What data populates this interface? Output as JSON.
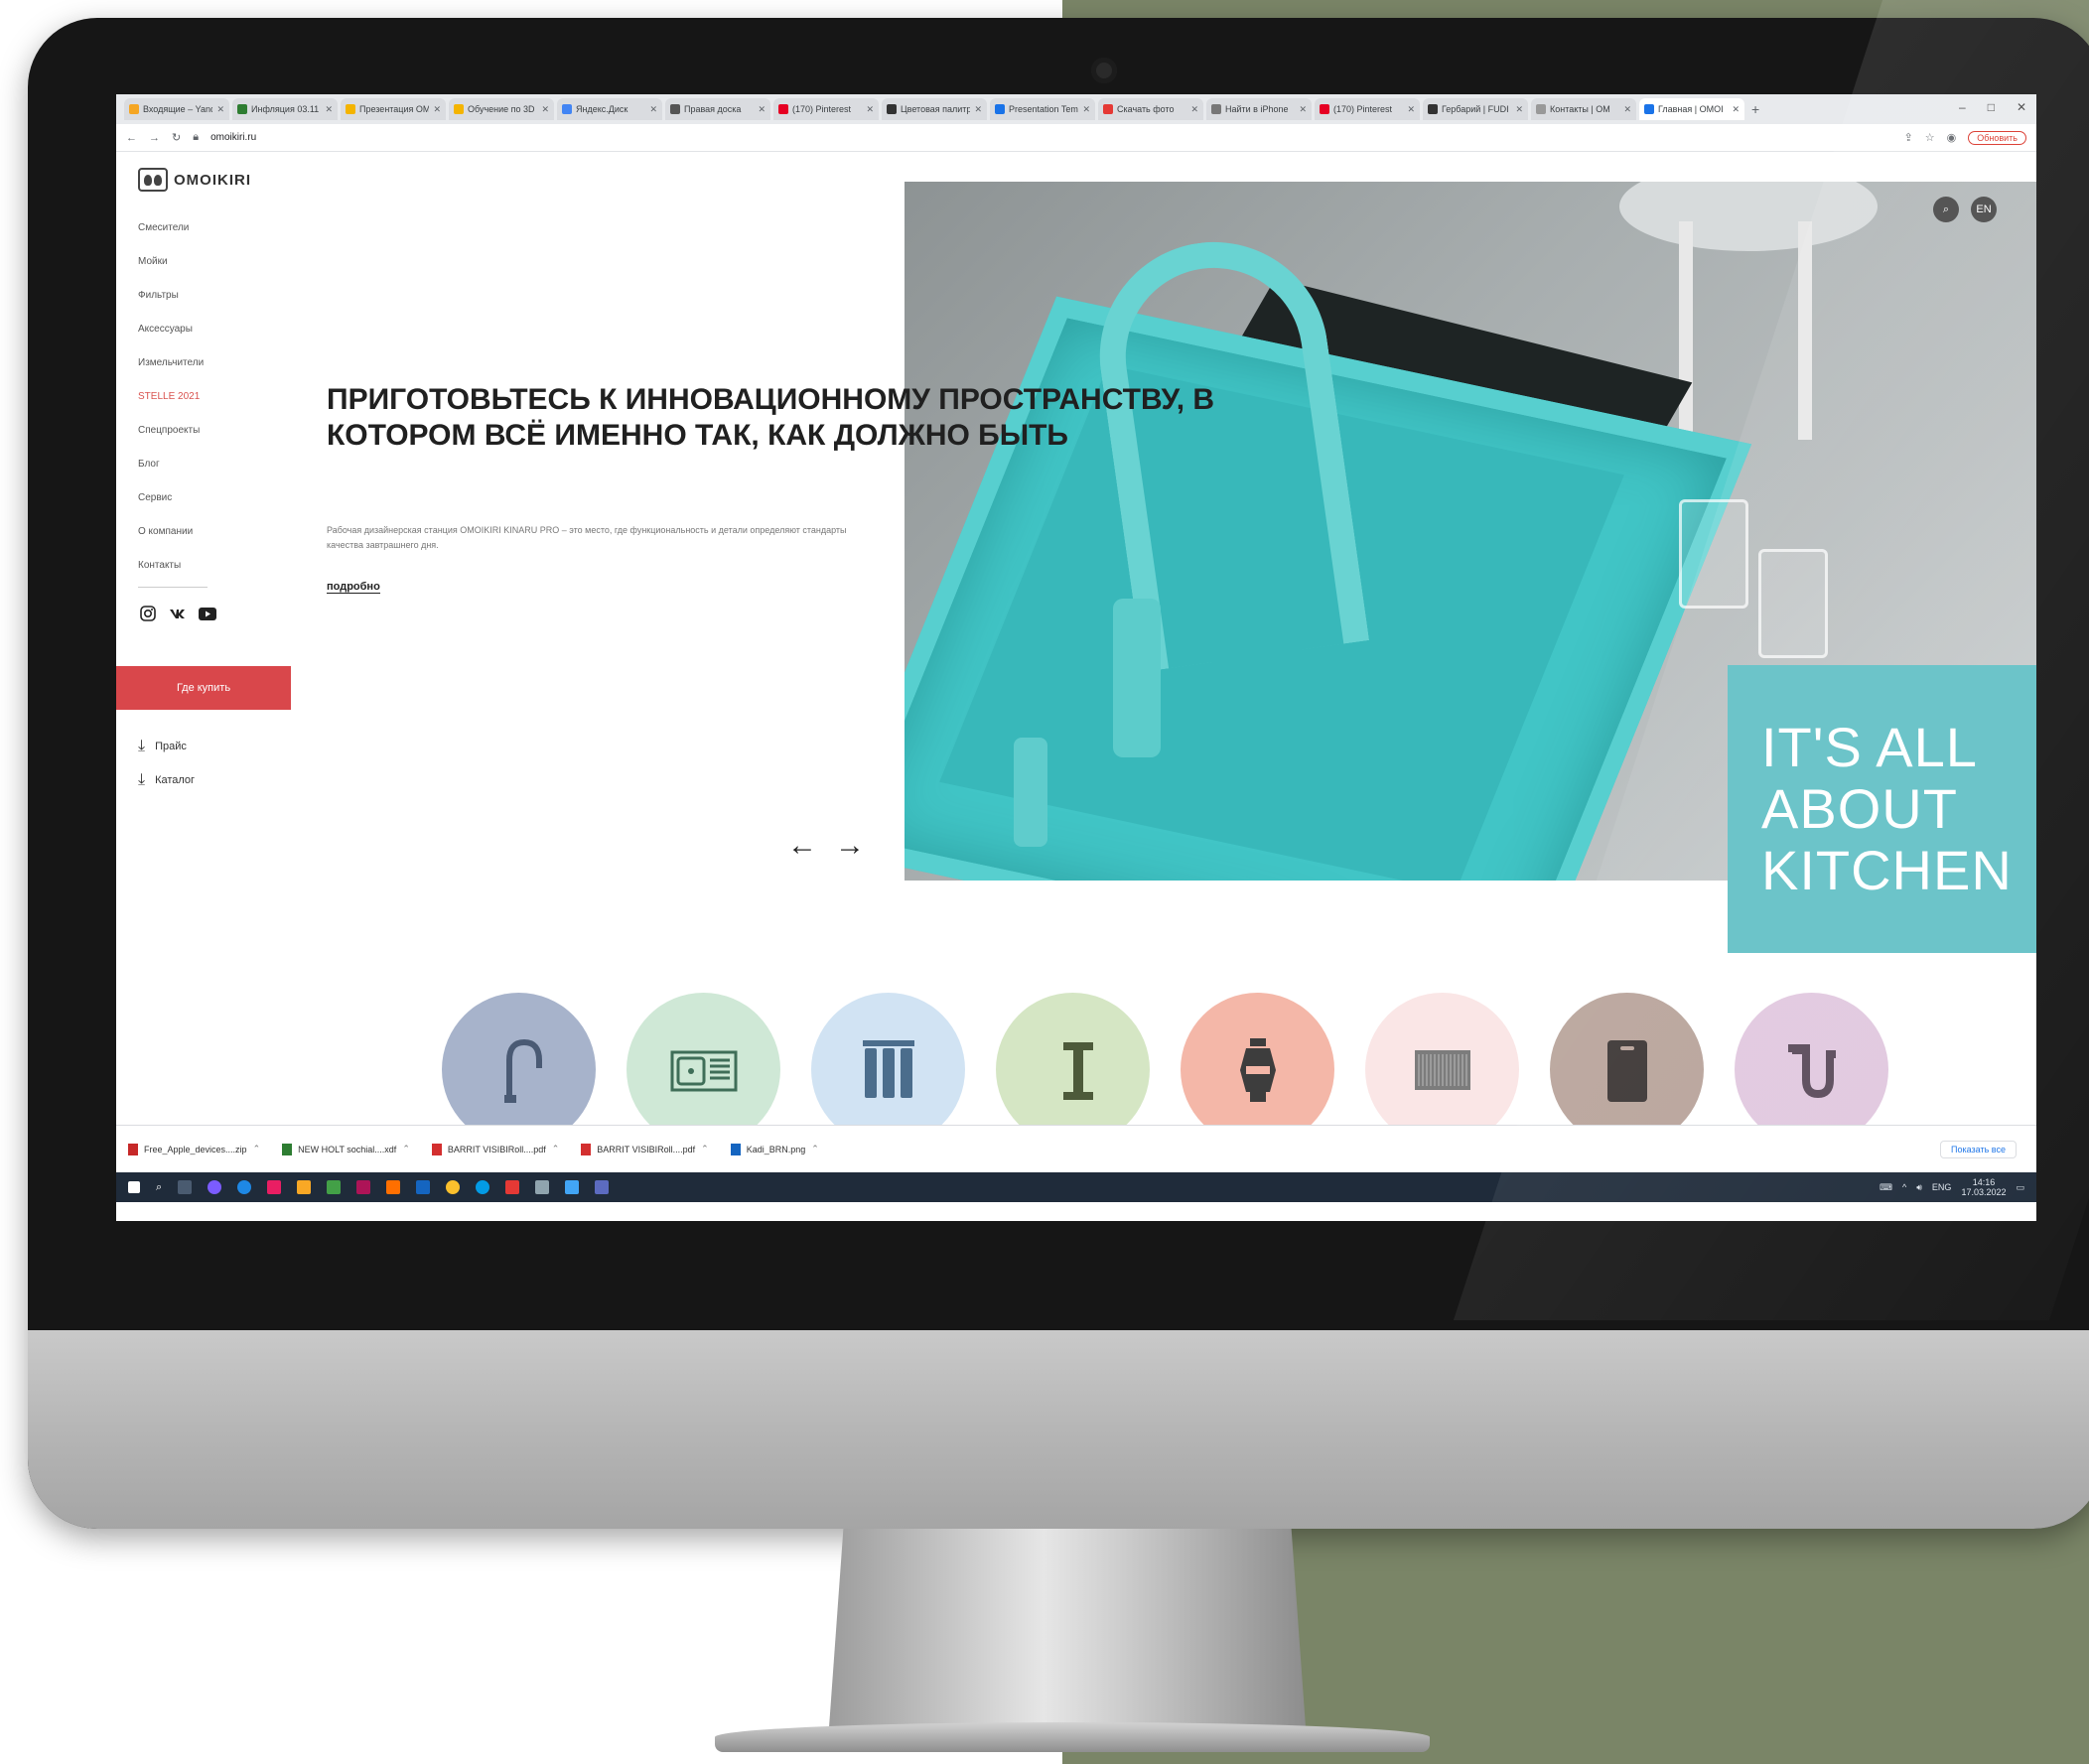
{
  "browser": {
    "tabs": [
      {
        "title": "Входящие – Yandex",
        "color": "#f5a623"
      },
      {
        "title": "Инфляция 03.11",
        "color": "#2e7d32"
      },
      {
        "title": "Презентация ОМ",
        "color": "#f4b400"
      },
      {
        "title": "Обучение по 3D",
        "color": "#f4b400"
      },
      {
        "title": "Яндекс.Диск",
        "color": "#4285f4"
      },
      {
        "title": "Правая доска",
        "color": "#555555"
      },
      {
        "title": "(170) Pinterest",
        "color": "#e60023"
      },
      {
        "title": "Цветовая палитра",
        "color": "#333333"
      },
      {
        "title": "Presentation Template",
        "color": "#1a73e8"
      },
      {
        "title": "Скачать фото",
        "color": "#e53935"
      },
      {
        "title": "Найти в iPhone",
        "color": "#777777"
      },
      {
        "title": "(170) Pinterest",
        "color": "#e60023"
      },
      {
        "title": "Гербарий | FUDI",
        "color": "#333333"
      },
      {
        "title": "Контакты | ОМ",
        "color": "#999999"
      },
      {
        "title": "Главная | OMOI",
        "color": "#1a73e8"
      }
    ],
    "url": "omoikiri.ru",
    "update_label": "Обновить",
    "window_controls": [
      "–",
      "□",
      "✕"
    ]
  },
  "site": {
    "logo_text": "OMOIKIRI",
    "nav": [
      {
        "label": "Смесители",
        "highlight": false
      },
      {
        "label": "Мойки",
        "highlight": false
      },
      {
        "label": "Фильтры",
        "highlight": false
      },
      {
        "label": "Аксессуары",
        "highlight": false
      },
      {
        "label": "Измельчители",
        "highlight": false
      },
      {
        "label": "STELLE 2021",
        "highlight": true
      },
      {
        "label": "Спецпроекты",
        "highlight": false
      },
      {
        "label": "Блог",
        "highlight": false
      },
      {
        "label": "Сервис",
        "highlight": false
      },
      {
        "label": "О компании",
        "highlight": false
      },
      {
        "label": "Контакты",
        "highlight": false
      }
    ],
    "socials": [
      "instagram-icon",
      "vk-icon",
      "youtube-icon"
    ],
    "buy_label": "Где купить",
    "price_label": "Прайс",
    "catalog_label": "Каталог"
  },
  "hero": {
    "title": "ПРИГОТОВЬТЕСЬ К ИННОВАЦИОННОМУ ПРОСТРАНСТВУ, В КОТОРОМ ВСЁ ИМЕННО ТАК, КАК ДОЛЖНО БЫТЬ",
    "subtitle": "Рабочая дизайнерская станция OMOIKIRI KINARU PRO – это место, где функциональность и детали определяют стандарты качества завтрашнего дня.",
    "more_label": "подробно",
    "arrow_prev": "←",
    "arrow_next": "→",
    "badge_text": "IT'S ALL ABOUT KITCHEN",
    "top_icons": [
      "search-icon",
      "language-icon"
    ],
    "language_label": "EN"
  },
  "categories": [
    {
      "name": "faucets",
      "color": "#a7b3cb",
      "icon": "faucet-icon"
    },
    {
      "name": "sinks",
      "color": "#cfe8d6",
      "icon": "sink-icon"
    },
    {
      "name": "filters",
      "color": "#d1e3f3",
      "icon": "filter-icon"
    },
    {
      "name": "dispensers",
      "color": "#d5e6c4",
      "icon": "dispenser-icon"
    },
    {
      "name": "disposers",
      "color": "#f4b7a8",
      "icon": "disposer-icon"
    },
    {
      "name": "mats",
      "color": "#fae6e6",
      "icon": "mat-icon"
    },
    {
      "name": "cutting-boards",
      "color": "#b8a39a",
      "icon": "board-icon"
    },
    {
      "name": "siphons",
      "color": "#e1c8df",
      "icon": "siphon-icon"
    }
  ],
  "downloads": {
    "files": [
      {
        "name": "Free_Apple_devices....zip",
        "color": "#c62828"
      },
      {
        "name": "NEW HOLT sochial....xdf",
        "color": "#2e7d32"
      },
      {
        "name": "BARRIT VISIBIRoll....pdf",
        "color": "#d32f2f"
      },
      {
        "name": "BARRIT VISIBIRoll....pdf",
        "color": "#d32f2f"
      },
      {
        "name": "Kadi_BRN.png",
        "color": "#1565c0"
      }
    ],
    "show_all_label": "Показать все"
  },
  "taskbar": {
    "clock": "14:16",
    "date": "17.03.2022",
    "lang": "ENG"
  }
}
